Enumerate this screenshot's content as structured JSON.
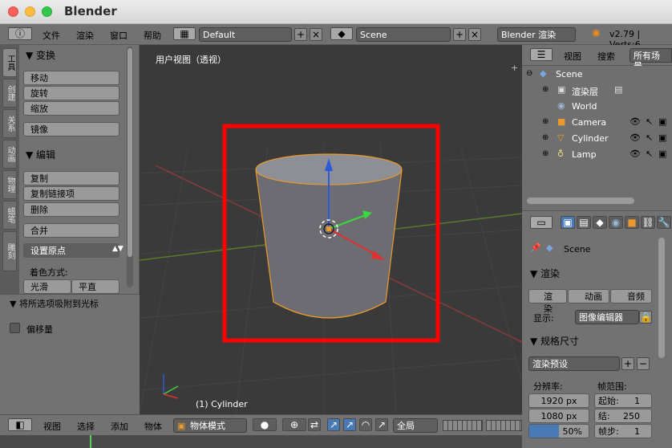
{
  "window": {
    "title": "Blender"
  },
  "topbar": {
    "menus": [
      "文件",
      "渲染",
      "窗口",
      "帮助"
    ],
    "layout": "Default",
    "scene": "Scene",
    "engine": "Blender 渲染",
    "version": "v2.79 | Verts:6"
  },
  "left_tabs": [
    "工具",
    "创建",
    "关系",
    "动画",
    "物理",
    "蜡笔",
    "雕刻"
  ],
  "tools": {
    "transform_header": "▼ 变换",
    "move": "移动",
    "rotate": "旋转",
    "scale": "缩放",
    "mirror": "镜像",
    "edit_header": "▼ 编辑",
    "duplicate": "复制",
    "duplicate_linked": "复制链接项",
    "delete": "删除",
    "join": "合并",
    "set_origin": "设置原点",
    "shading_label": "着色方式:",
    "smooth": "光滑",
    "flat": "平直"
  },
  "operator": {
    "header": "▼ 将所选项吸附到光标",
    "offset": "偏移量"
  },
  "viewport": {
    "title": "用户视图（透视）",
    "object_label": "(1) Cylinder"
  },
  "bottombar": {
    "items": [
      "视图",
      "选择",
      "添加",
      "物体"
    ],
    "mode": "物体模式",
    "pivot": "全局"
  },
  "outliner": {
    "view": "视图",
    "search": "搜索",
    "filter": "所有场景",
    "rows": [
      "Scene",
      "渲染层",
      "World",
      "Camera",
      "Cylinder",
      "Lamp"
    ]
  },
  "properties": {
    "scene_label": "Scene",
    "render_header": "▼ 渲染",
    "render_btn": "渲染",
    "anim_btn": "动画",
    "audio_btn": "音频",
    "display_label": "显示:",
    "display_value": "图像编辑器",
    "dims_header": "▼ 规格尺寸",
    "preset": "渲染预设",
    "resolution_label": "分辨率:",
    "frame_range_label": "帧范围:",
    "res_x": "1920 px",
    "res_y": "1080 px",
    "res_pct": "50%",
    "start": "起始:",
    "start_val": "1",
    "end": "结:",
    "end_val": "250",
    "step": "帧步:",
    "step_val": "1"
  },
  "colors": {
    "selection_box": "#ff0000",
    "accent_blue": "#4a7ab5",
    "bg": "#727272"
  }
}
